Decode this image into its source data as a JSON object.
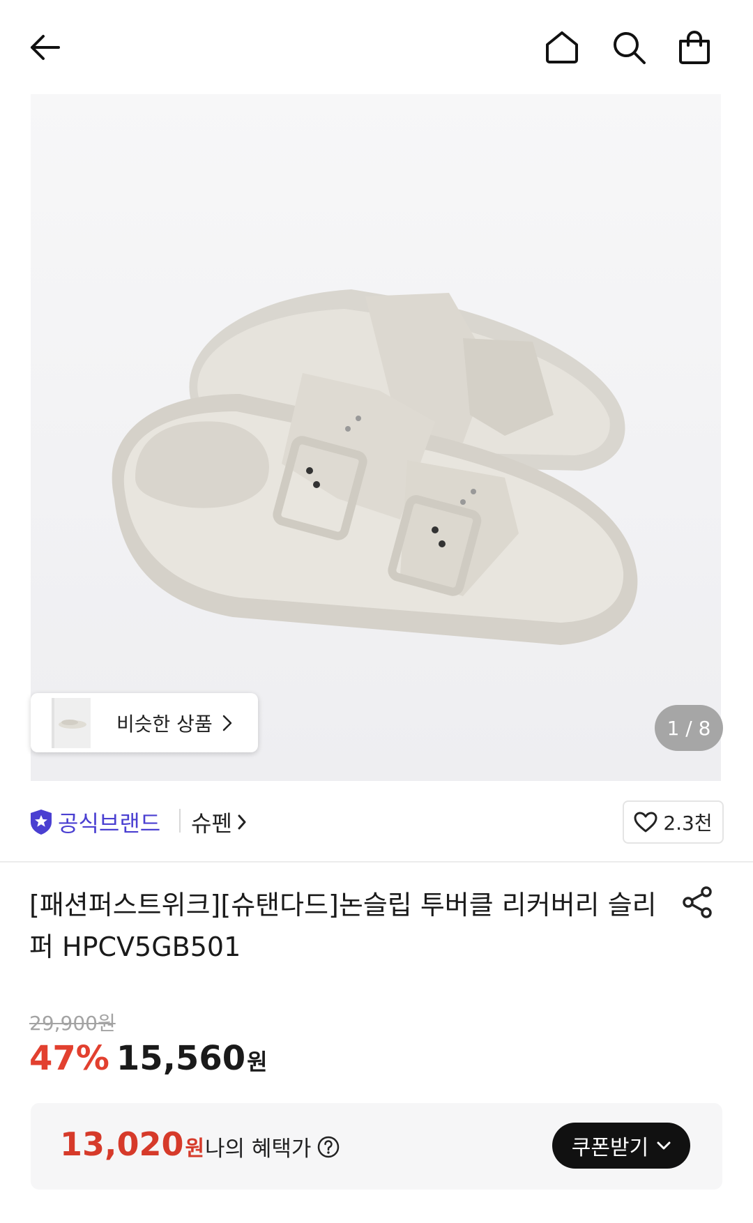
{
  "header": {
    "back_icon": "arrow-left-icon",
    "home_icon": "home-icon",
    "search_icon": "search-icon",
    "bag_icon": "shopping-bag-icon"
  },
  "gallery": {
    "similar_label": "비슷한 상품",
    "counter": "1 / 8"
  },
  "brand": {
    "official_label": "공식브랜드",
    "brand_name": "슈펜",
    "likes": "2.3천"
  },
  "product": {
    "title": "[패션퍼스트위크][슈탠다드]논슬립 투버클 리커버리 슬리퍼 HPCV5GB501",
    "original_price": "29,900원",
    "discount": "47%",
    "price": "15,560",
    "price_unit": "원"
  },
  "benefit": {
    "price": "13,020",
    "price_unit": "원",
    "label": "나의 혜택가",
    "coupon_button": "쿠폰받기"
  },
  "colors": {
    "accent_red": "#e2402f",
    "official_purple": "#4a3fd1"
  }
}
